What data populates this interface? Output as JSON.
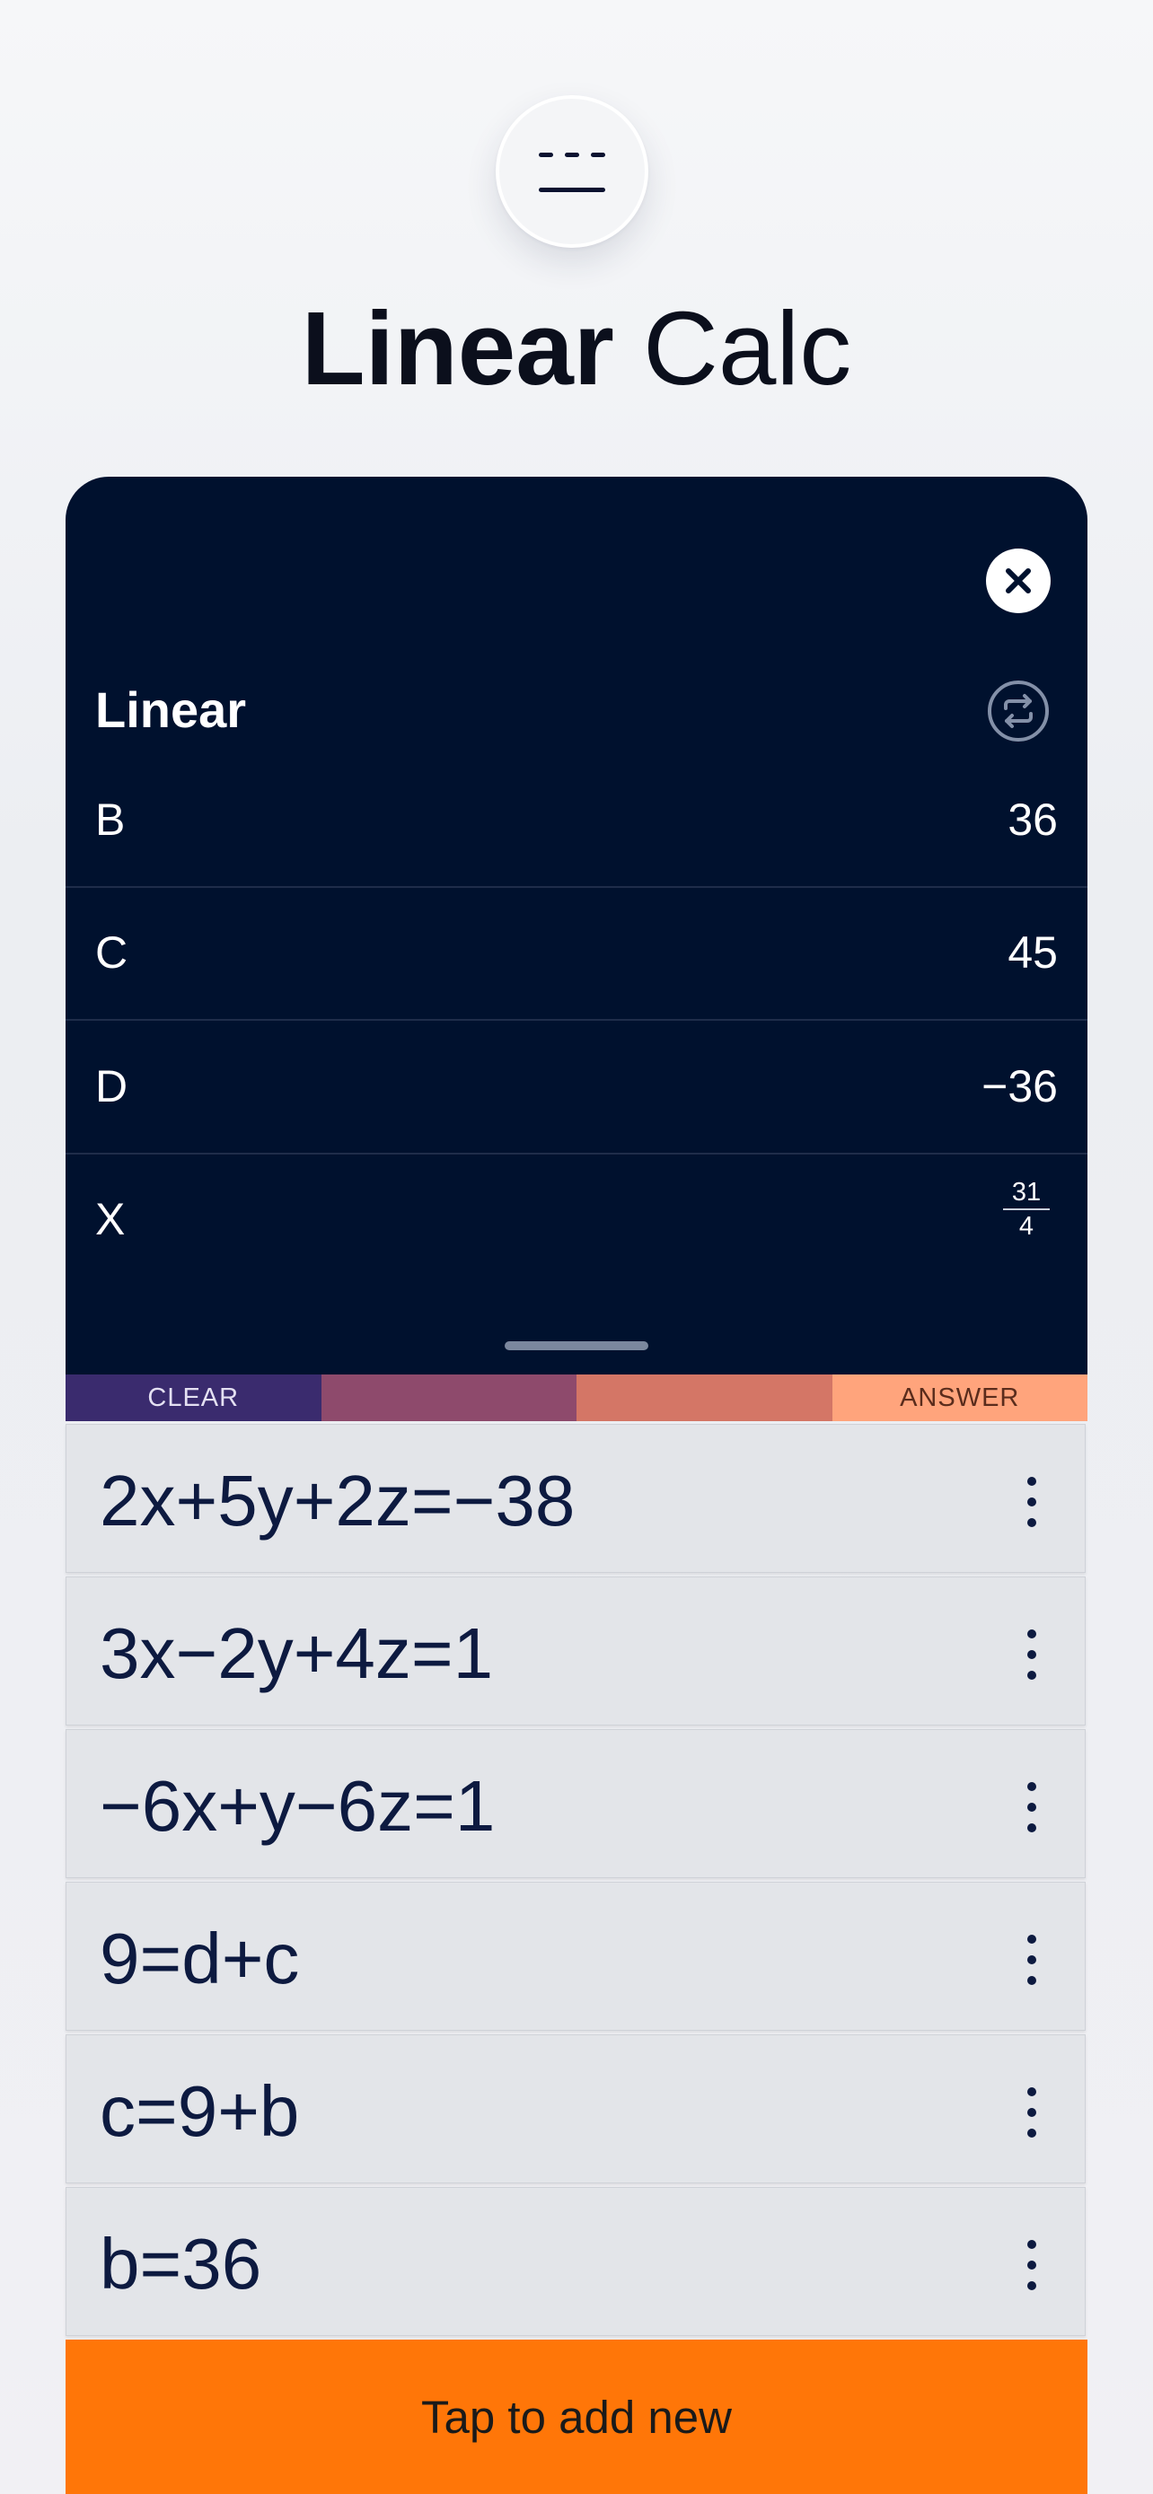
{
  "app": {
    "title_bold": "Linear",
    "title_regular": "Calc"
  },
  "panel": {
    "title": "Linear",
    "variables": [
      {
        "name": "B",
        "value": "36"
      },
      {
        "name": "C",
        "value": "45"
      },
      {
        "name": "D",
        "value": "−36"
      },
      {
        "name": "X",
        "value": "",
        "fraction": {
          "numerator": "31",
          "denominator": "4"
        }
      }
    ]
  },
  "band": {
    "clear_label": "CLEAR",
    "answer_label": "ANSWER",
    "colors": [
      "#3a2b6e",
      "#8e4a6c",
      "#d47666",
      "#ffa47c"
    ]
  },
  "equations": [
    "2x+5y+2z=−38",
    "3x−2y+4z=1",
    "−6x+y−6z=1",
    "9=d+c",
    "c=9+b",
    "b=36"
  ],
  "add_new": {
    "label": "Tap to add new"
  },
  "colors": {
    "panel_bg": "#00112e",
    "accent_orange": "#ff7608",
    "equation_bg": "#e3e5e9"
  },
  "icons": [
    "menu-icon",
    "close-icon",
    "swap-icon",
    "more-vertical-icon"
  ]
}
